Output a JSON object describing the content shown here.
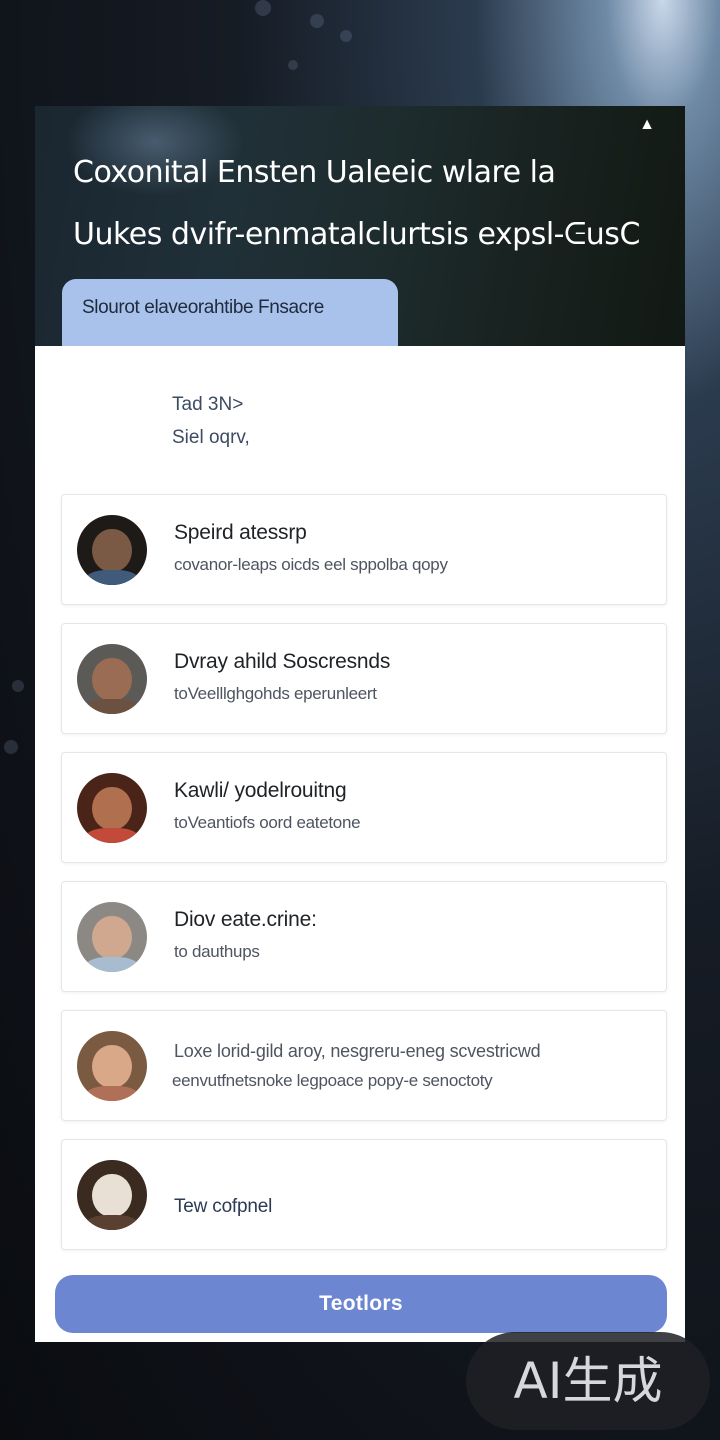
{
  "hero": {
    "title_line1": "Coxonital Ensten Ualeeic wlare la",
    "title_line2": "Uukes dvifr-enmatalclurtsis expsl-ᕮusC",
    "tab_label": "Slourot elaveorahtibe Fnsacre",
    "up_icon": "triangle-up-icon"
  },
  "intro": {
    "line1": "Tad 3N>",
    "line2": "Siel oqrv,"
  },
  "items": [
    {
      "title": "Speird atessrp",
      "subtitle": "covanor-leaps oicds eel sppolba qopy",
      "avatar_colors": [
        "#1e1a18",
        "#7a5a44",
        "#3f5a7a"
      ]
    },
    {
      "title": "Dvray ahild Soscresnds",
      "subtitle": "toVeelllghgohds eperunleert",
      "avatar_colors": [
        "#5c5a57",
        "#9a6c54",
        "#6c5040"
      ]
    },
    {
      "title": "Kawli/ yodelrouitng",
      "subtitle": "toVeantiofs oord eatetone",
      "avatar_colors": [
        "#4a2418",
        "#b0704f",
        "#c24a3a"
      ]
    },
    {
      "title": "Diov eate.crine:",
      "subtitle": "to dauthups",
      "avatar_colors": [
        "#8c8884",
        "#d0a890",
        "#a8bcd0"
      ]
    },
    {
      "title": "Loxe lorid-gild aroy, nesgreru-eneg scvestricwd",
      "subtitle": "eenvutfnetsnoke legpoace popy-e senoctoty",
      "avatar_colors": [
        "#7a5a40",
        "#d8a888",
        "#b07058"
      ]
    },
    {
      "title": "Tew cofpnel",
      "subtitle": "",
      "avatar_colors": [
        "#3a2a20",
        "#e8e0d4",
        "#5a4030"
      ]
    }
  ],
  "cta": {
    "label": "Teotlors"
  },
  "watermark": {
    "text": "AI生成"
  },
  "colors": {
    "accent_tab": "#a9c2ec",
    "accent_button": "#6c86d2"
  }
}
